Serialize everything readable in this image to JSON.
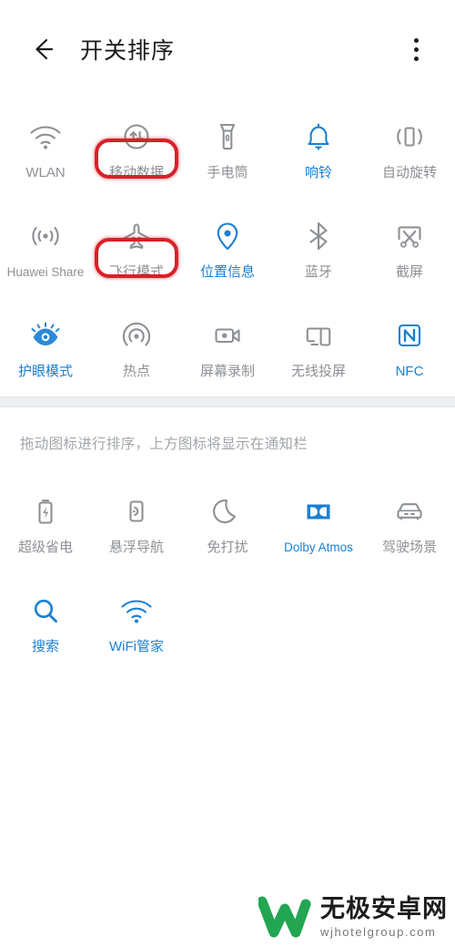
{
  "header": {
    "back_icon": "arrow-left-icon",
    "title": "开关排序",
    "overflow_icon": "more-vertical-icon"
  },
  "colors": {
    "active_blue": "#1a7fd4",
    "inactive_gray": "#8d9094",
    "annotation_red": "#d8202a",
    "divider": "#eceef0",
    "watermark_green": "#22a651"
  },
  "top_section": {
    "tiles": [
      {
        "label": "WLAN",
        "icon": "wifi-icon",
        "active": false,
        "highlighted": false
      },
      {
        "label": "移动数据",
        "icon": "mobile-data-icon",
        "active": false,
        "highlighted": true
      },
      {
        "label": "手电筒",
        "icon": "flashlight-icon",
        "active": false,
        "highlighted": false
      },
      {
        "label": "响铃",
        "icon": "bell-icon",
        "active": true,
        "highlighted": false
      },
      {
        "label": "自动旋转",
        "icon": "auto-rotate-icon",
        "active": false,
        "highlighted": false
      },
      {
        "label": "Huawei Share",
        "icon": "huawei-share-icon",
        "active": false,
        "highlighted": false
      },
      {
        "label": "飞行模式",
        "icon": "airplane-icon",
        "active": false,
        "highlighted": true
      },
      {
        "label": "位置信息",
        "icon": "location-pin-icon",
        "active": true,
        "highlighted": false
      },
      {
        "label": "蓝牙",
        "icon": "bluetooth-icon",
        "active": false,
        "highlighted": false
      },
      {
        "label": "截屏",
        "icon": "screenshot-icon",
        "active": false,
        "highlighted": false
      },
      {
        "label": "护眼模式",
        "icon": "eye-comfort-icon",
        "active": true,
        "highlighted": false
      },
      {
        "label": "热点",
        "icon": "hotspot-icon",
        "active": false,
        "highlighted": false
      },
      {
        "label": "屏幕录制",
        "icon": "screen-record-icon",
        "active": false,
        "highlighted": false
      },
      {
        "label": "无线投屏",
        "icon": "cast-screen-icon",
        "active": false,
        "highlighted": false
      },
      {
        "label": "NFC",
        "icon": "nfc-icon",
        "active": true,
        "highlighted": false
      }
    ]
  },
  "hint": "拖动图标进行排序，上方图标将显示在通知栏",
  "bottom_section": {
    "tiles": [
      {
        "label": "超级省电",
        "icon": "battery-saver-icon",
        "active": false
      },
      {
        "label": "悬浮导航",
        "icon": "floating-nav-icon",
        "active": false
      },
      {
        "label": "免打扰",
        "icon": "moon-icon",
        "active": false
      },
      {
        "label": "Dolby Atmos",
        "icon": "dolby-atmos-icon",
        "active": true
      },
      {
        "label": "驾驶场景",
        "icon": "car-icon",
        "active": false
      },
      {
        "label": "搜索",
        "icon": "search-icon",
        "active": true
      },
      {
        "label": "WiFi管家",
        "icon": "wifi-manager-icon",
        "active": true
      }
    ]
  },
  "watermark": {
    "logo_icon": "w-logo-icon",
    "title": "无极安卓网",
    "url": "wjhotelgroup.com"
  }
}
